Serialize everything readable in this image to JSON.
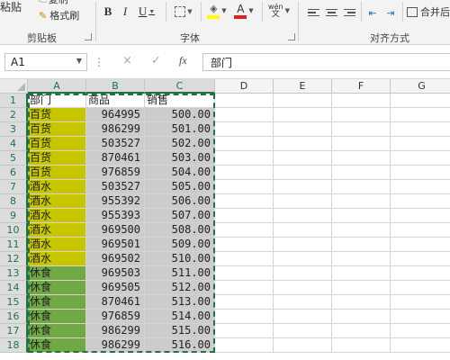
{
  "ribbon": {
    "clipboard": {
      "paste_label": "粘贴",
      "copy_label": "复制",
      "format_painter_label": "格式刷",
      "group_label": "剪贴板"
    },
    "font": {
      "bold": "B",
      "italic": "I",
      "underline": "U",
      "fill_letter": "A",
      "font_color_letter": "A",
      "fill_color": "#ffff00",
      "font_color": "#e02020",
      "phonetic_label": "wén",
      "group_label": "字体"
    },
    "alignment": {
      "merge_label": "合并后",
      "group_label": "对齐方式"
    }
  },
  "formula_bar": {
    "cell_ref": "A1",
    "fx_label": "fx",
    "cancel_glyph": "×",
    "enter_glyph": "✓",
    "content": "部门"
  },
  "columns": [
    "A",
    "B",
    "C",
    "D",
    "E",
    "F",
    "G"
  ],
  "rows": [
    "1",
    "2",
    "3",
    "4",
    "5",
    "6",
    "7",
    "8",
    "9",
    "10",
    "11",
    "12",
    "13",
    "14",
    "15",
    "16",
    "17",
    "18"
  ],
  "colors": {
    "baihuo": "#c7c400",
    "jiushui": "#c7c400",
    "xiushi": "#70a844",
    "gray": "#cccccc",
    "accent": "#217346"
  },
  "sheet": {
    "header": [
      "部门",
      "商品",
      "销售"
    ],
    "data": [
      [
        "百货",
        "964995",
        "500.00"
      ],
      [
        "百货",
        "986299",
        "501.00"
      ],
      [
        "百货",
        "503527",
        "502.00"
      ],
      [
        "百货",
        "870461",
        "503.00"
      ],
      [
        "百货",
        "976859",
        "504.00"
      ],
      [
        "酒水",
        "503527",
        "505.00"
      ],
      [
        "酒水",
        "955392",
        "506.00"
      ],
      [
        "酒水",
        "955393",
        "507.00"
      ],
      [
        "酒水",
        "969500",
        "508.00"
      ],
      [
        "酒水",
        "969501",
        "509.00"
      ],
      [
        "酒水",
        "969502",
        "510.00"
      ],
      [
        "休食",
        "969503",
        "511.00"
      ],
      [
        "休食",
        "969505",
        "512.00"
      ],
      [
        "休食",
        "870461",
        "513.00"
      ],
      [
        "休食",
        "976859",
        "514.00"
      ],
      [
        "休食",
        "986299",
        "515.00"
      ],
      [
        "休食",
        "986299",
        "516.00"
      ]
    ]
  }
}
